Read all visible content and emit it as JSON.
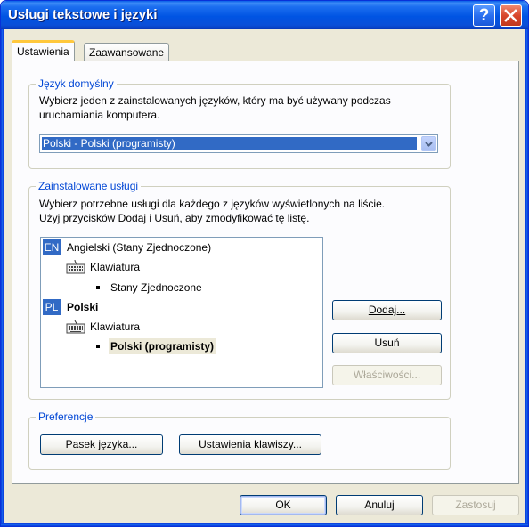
{
  "window": {
    "title": "Usługi tekstowe i języki",
    "help_glyph": "?"
  },
  "tabs": [
    {
      "label": "Ustawienia",
      "active": true
    },
    {
      "label": "Zaawansowane",
      "active": false
    }
  ],
  "default_language": {
    "legend": "Język domyślny",
    "description_line1": "Wybierz jeden z zainstalowanych języków, który ma być używany podczas",
    "description_line2": "uruchamiania komputera.",
    "selected": "Polski - Polski (programisty)"
  },
  "installed_services": {
    "legend": "Zainstalowane usługi",
    "description_line1": "Wybierz potrzebne usługi dla każdego z języków wyświetlonych na liście.",
    "description_line2": "Użyj przycisków Dodaj i Usuń, aby zmodyfikować tę listę.",
    "tree": {
      "en": {
        "badge": "EN",
        "language": "Angielski (Stany Zjednoczone)",
        "category": "Klawiatura",
        "layout": "Stany Zjednoczone"
      },
      "pl": {
        "badge": "PL",
        "language": "Polski",
        "category": "Klawiatura",
        "layout": "Polski (programisty)"
      }
    },
    "buttons": {
      "add": "Dodaj...",
      "remove": "Usuń",
      "properties": "Właściwości..."
    }
  },
  "preferences": {
    "legend": "Preferencje",
    "language_bar": "Pasek języka...",
    "key_settings": "Ustawienia klawiszy..."
  },
  "footer": {
    "ok": "OK",
    "cancel": "Anuluj",
    "apply": "Zastosuj"
  },
  "colors": {
    "title_bar": "#0054e3",
    "selection": "#316ac5",
    "group_legend": "#0046d5"
  }
}
